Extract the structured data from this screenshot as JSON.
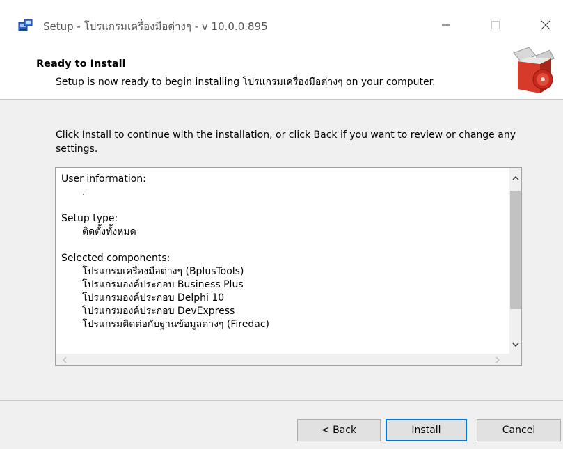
{
  "window": {
    "title": "Setup - โปรแกรมเครื่องมือต่างๆ - v 10.0.0.895"
  },
  "header": {
    "title": "Ready to Install",
    "subtitle": "Setup is now ready to begin installing โปรแกรมเครื่องมือต่างๆ on your computer."
  },
  "intro": "Click Install to continue with the installation, or click Back if you want to review or change any settings.",
  "memo": {
    "user_info_label": "User information:",
    "user_info_value": ".",
    "setup_type_label": "Setup type:",
    "setup_type_value": "ติดตั้งทั้งหมด",
    "components_label": "Selected components:",
    "components": [
      "โปรแกรมเครื่องมือต่างๆ (BplusTools)",
      "โปรแกรมองค์ประกอบ Business Plus",
      "โปรแกรมองค์ประกอบ Delphi 10",
      "โปรแกรมองค์ประกอบ DevExpress",
      "โปรแกรมติดต่อกับฐานข้อมูลต่างๆ (Firedac)"
    ]
  },
  "buttons": {
    "back": "< Back",
    "install": "Install",
    "cancel": "Cancel"
  },
  "icons": {
    "app": "setup-icon",
    "minimize": "minimize-icon",
    "maximize": "maximize-icon",
    "close": "close-icon",
    "header_graphic": "install-box-icon"
  },
  "colors": {
    "accent": "#0078d7",
    "panel": "#f0f0f0",
    "scroll_thumb": "#c2c2c2"
  }
}
